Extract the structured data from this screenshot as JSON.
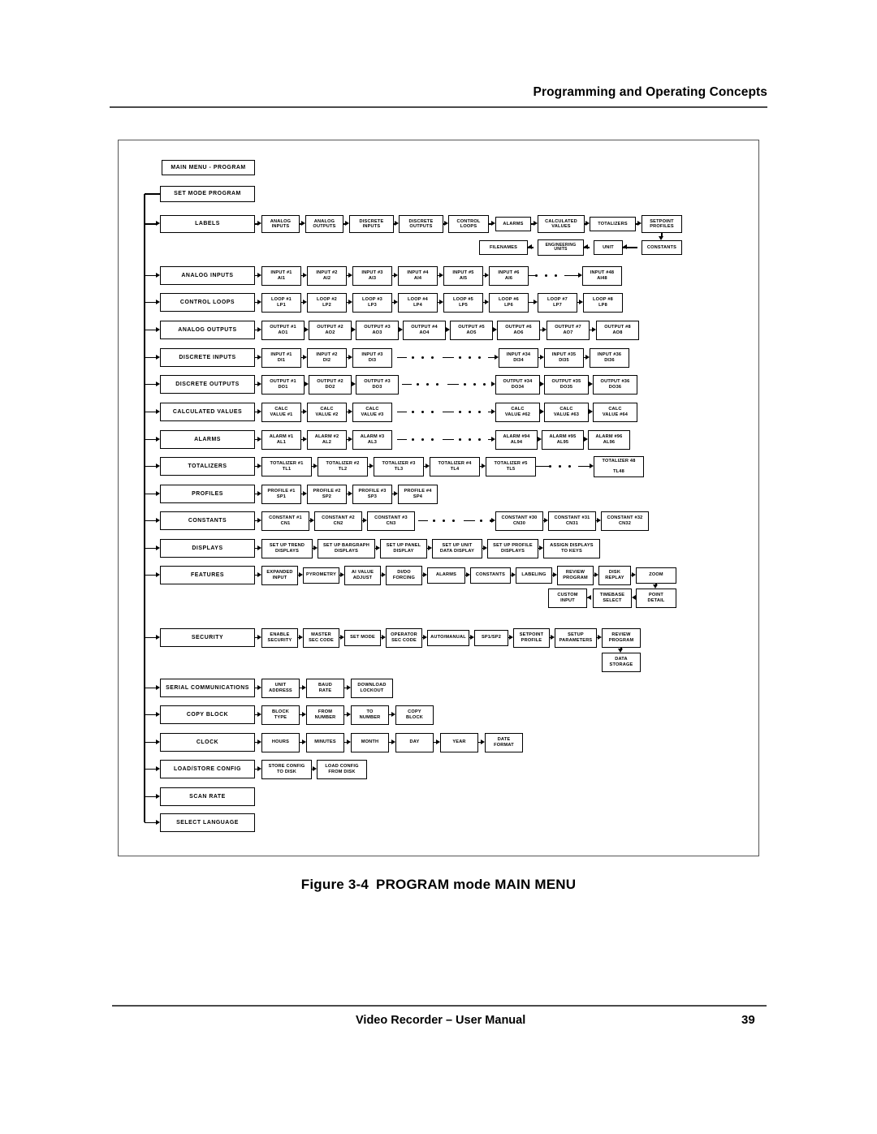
{
  "page": {
    "header_title": "Programming and Operating Concepts",
    "figure_caption_number": "Figure 3-4",
    "figure_caption_title": "PROGRAM mode MAIN MENU",
    "footer_title": "Video Recorder – User Manual",
    "footer_page_number": "39"
  },
  "diagram": {
    "title_box": "MAIN MENU -  PROGRAM",
    "mode_box": "SET MODE   PROGRAM",
    "rows": [
      {
        "name": "labels",
        "main": "LABELS",
        "items": [
          "ANALOG\nINPUTS",
          "ANALOG\nOUTPUTS",
          "DISCRETE\nINPUTS",
          "DISCRETE\nOUTPUTS",
          "CONTROL\nLOOPS",
          "ALARMS",
          "CALCULATED\nVALUES",
          "TOTALIZERS",
          "SETPOINT\nPROFILES"
        ],
        "wrap_items": [
          "CONSTANTS",
          "UNIT",
          "ENGINEERING\nUNITS",
          "FILENAMES"
        ]
      },
      {
        "name": "analog-inputs",
        "main": "ANALOG INPUTS",
        "items": [
          "INPUT #1\nAI1",
          "INPUT #2\nAI2",
          "INPUT #3\nAI3",
          "INPUT #4\nAI4",
          "INPUT #5\nAI5",
          "INPUT #6\nAI6"
        ],
        "tail": [
          "INPUT #48\nAI48"
        ]
      },
      {
        "name": "control-loops",
        "main": "CONTROL LOOPS",
        "items": [
          "LOOP #1\nLP1",
          "LOOP #2\nLP2",
          "LOOP #3\nLP3",
          "LOOP #4\nLP4",
          "LOOP #5\nLP5",
          "LOOP #6\nLP6",
          "LOOP #7\nLP7",
          "LOOP #8\nLP8"
        ]
      },
      {
        "name": "analog-outputs",
        "main": "ANALOG OUTPUTS",
        "items": [
          "OUTPUT #1\nAO1",
          "OUTPUT #2\nAO2",
          "OUTPUT #3\nAO3",
          "OUTPUT #4\nAO4",
          "OUTPUT #5\nAO5",
          "OUTPUT #6\nAO6",
          "OUTPUT #7\nAO7",
          "OUTPUT #8\nAO8"
        ]
      },
      {
        "name": "discrete-inputs",
        "main": "DISCRETE INPUTS",
        "items": [
          "INPUT #1\nDI1",
          "INPUT #2\nDI2",
          "INPUT #3\nDI3"
        ],
        "tail": [
          "INPUT #34\nDI34",
          "INPUT #35\nDI35",
          "INPUT #36\nDI36"
        ]
      },
      {
        "name": "discrete-outputs",
        "main": "DISCRETE OUTPUTS",
        "items": [
          "OUTPUT #1\nDO1",
          "OUTPUT #2\nDO2",
          "OUTPUT #3\nDO3"
        ],
        "tail": [
          "OUTPUT #34\nDO34",
          "OUTPUT #35\nDO35",
          "OUTPUT #36\nDO36"
        ]
      },
      {
        "name": "calculated-values",
        "main": "CALCULATED VALUES",
        "items": [
          "CALC\nVALUE #1",
          "CALC\nVALUE #2",
          "CALC\nVALUE #3"
        ],
        "tail": [
          "CALC\nVALUE #62",
          "CALC\nVALUE #63",
          "CALC\nVALUE #64"
        ]
      },
      {
        "name": "alarms",
        "main": "ALARMS",
        "items": [
          "ALARM #1\nAL1",
          "ALARM #2\nAL2",
          "ALARM #3\nAL3"
        ],
        "tail": [
          "ALARM #94\nAL94",
          "ALARM #95\nAL95",
          "ALARM #96\nAL96"
        ]
      },
      {
        "name": "totalizers",
        "main": "TOTALIZERS",
        "items": [
          "TOTALIZER #1\nTL1",
          "TOTALIZER #2\nTL2",
          "TOTALIZER #3\nTL3",
          "TOTALIZER #4\nTL4",
          "TOTALIZER #5\nTL5"
        ],
        "tail": [
          "TOTALIZER 48\n\nTL48"
        ]
      },
      {
        "name": "profiles",
        "main": "PROFILES",
        "items": [
          "PROFILE #1\nSP1",
          "PROFILE #2\nSP2",
          "PROFILE #3\nSP3",
          "PROFILE #4\nSP4"
        ]
      },
      {
        "name": "constants",
        "main": "CONSTANTS",
        "items": [
          "CONSTANT #1\nCN1",
          "CONSTANT #2\nCN2",
          "CONSTANT #3\nCN3"
        ],
        "tail": [
          "CONSTANT #30\nCN30",
          "CONSTANT #31\nCN31",
          "CONSTANT #32\nCN32"
        ]
      },
      {
        "name": "displays",
        "main": "DISPLAYS",
        "items": [
          "SET UP TREND\nDISPLAYS",
          "SET UP BARGRAPH\nDISPLAYS",
          "SET UP PANEL\nDISPLAY",
          "SET UP UNIT\nDATA DISPLAY",
          "SET UP PROFILE\nDISPLAYS",
          "ASSIGN DISPLAYS\nTO KEYS"
        ]
      },
      {
        "name": "features",
        "main": "FEATURES",
        "items": [
          "EXPANDED\nINPUT",
          "PYROMETRY",
          "AI VALUE\nADJUST",
          "DI/DO\nFORCING",
          "ALARMS",
          "CONSTANTS",
          "LABELING",
          "REVIEW\nPROGRAM",
          "DISK\nREPLAY",
          "ZOOM"
        ],
        "wrap_items": [
          "POINT\nDETAIL",
          "TIMEBASE\nSELECT",
          "CUSTOM\nINPUT"
        ]
      },
      {
        "name": "security",
        "main": "SECURITY",
        "items": [
          "ENABLE\nSECURITY",
          "MASTER\nSEC CODE",
          "SET MODE",
          "OPERATOR\nSEC CODE",
          "AUTO/MANUAL",
          "SP1/SP2",
          "SETPOINT\nPROFILE",
          "SETUP\nPARAMETERS",
          "REVIEW\nPROGRAM"
        ],
        "wrap_items": [
          "DATA\nSTORAGE"
        ]
      },
      {
        "name": "serial-communications",
        "main": "SERIAL COMMUNICATIONS",
        "items": [
          "UNIT\nADDRESS",
          "BAUD\nRATE",
          "DOWNLOAD\nLOCKOUT"
        ]
      },
      {
        "name": "copy-block",
        "main": "COPY BLOCK",
        "items": [
          "BLOCK\nTYPE",
          "FROM\nNUMBER",
          "TO\nNUMBER",
          "COPY\nBLOCK"
        ]
      },
      {
        "name": "clock",
        "main": "CLOCK",
        "items": [
          "HOURS",
          "MINUTES",
          "MONTH",
          "DAY",
          "YEAR",
          "DATE\nFORMAT"
        ]
      },
      {
        "name": "load-store-config",
        "main": "LOAD/STORE CONFIG",
        "items": [
          "STORE CONFIG\nTO DISK",
          "LOAD CONFIG\nFROM DISK"
        ]
      },
      {
        "name": "scan-rate",
        "main": "SCAN RATE",
        "items": []
      },
      {
        "name": "select-language",
        "main": "SELECT LANGUAGE",
        "items": []
      }
    ]
  }
}
